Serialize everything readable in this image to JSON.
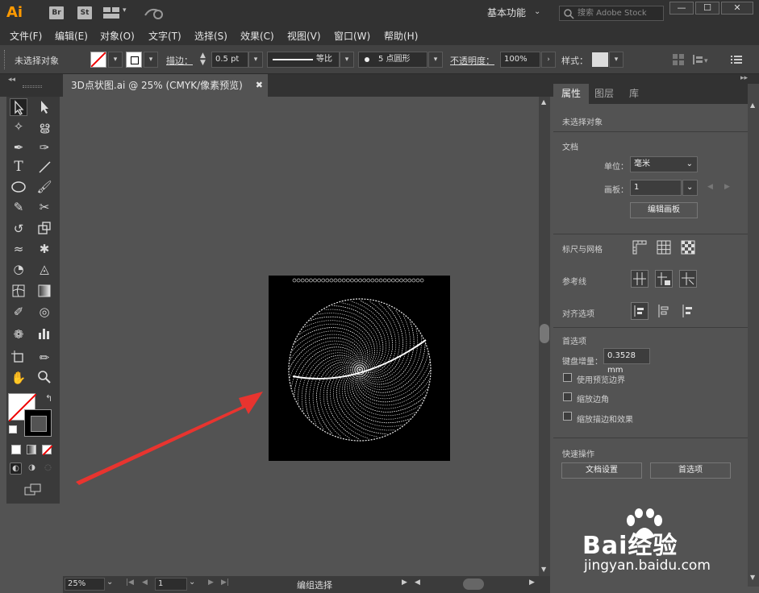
{
  "app": {
    "logo": "Ai",
    "badges": [
      "Br",
      "St"
    ],
    "workspace": "基本功能",
    "search_placeholder": "搜索 Adobe Stock",
    "window_buttons": [
      "—",
      "☐",
      "✕"
    ]
  },
  "menubar": [
    "文件(F)",
    "编辑(E)",
    "对象(O)",
    "文字(T)",
    "选择(S)",
    "效果(C)",
    "视图(V)",
    "窗口(W)",
    "帮助(H)"
  ],
  "control": {
    "selection": "未选择对象",
    "stroke_label": "描边：",
    "stroke_value": "0.5 pt",
    "profile": "等比",
    "brush": "5 点圆形",
    "opacity_label": "不透明度：",
    "opacity_value": "100%",
    "style_label": "样式："
  },
  "document": {
    "tab_title": "3D点状图.ai @ 25% (CMYK/像素预览)"
  },
  "status": {
    "zoom": "25%",
    "artboard": "1",
    "info": "编组选择"
  },
  "panel": {
    "tabs": [
      "属性",
      "图层",
      "库"
    ],
    "no_selection": "未选择对象",
    "doc_section": "文档",
    "units_label": "单位：",
    "units_value": "毫米",
    "artboard_label": "画板：",
    "artboard_value": "1",
    "edit_artboard": "编辑画板",
    "rulers_grid": "标尺与网格",
    "guides": "参考线",
    "align_options": "对齐选项",
    "preferences_section": "首选项",
    "key_increment_label": "键盘增量：",
    "key_increment_value": "0.3528 mm",
    "checkboxes": [
      "使用预览边界",
      "缩放边角",
      "缩放描边和效果"
    ],
    "quick_actions": "快速操作",
    "doc_setup_btn": "文档设置",
    "prefs_btn": "首选项"
  },
  "watermark": {
    "brand": "Bai经验",
    "url": "jingyan.baidu.com"
  },
  "colors": {
    "arrow": "#e8342f",
    "accent": "#ff9a00"
  }
}
